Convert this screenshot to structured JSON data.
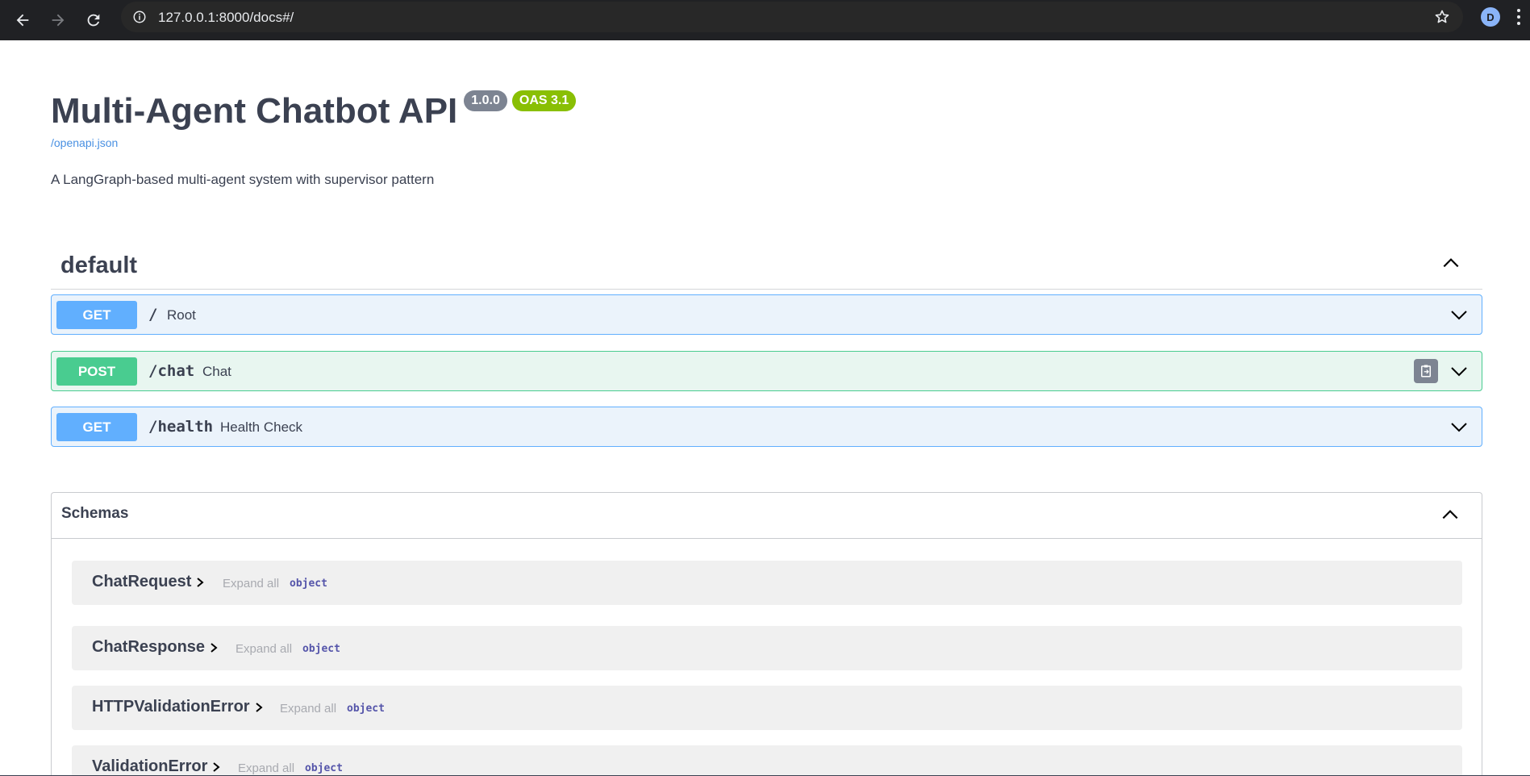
{
  "browser": {
    "url": "127.0.0.1:8000/docs#/",
    "avatar_letter": "D"
  },
  "info": {
    "title": "Multi-Agent Chatbot API",
    "version_badge": "1.0.0",
    "oas_badge": "OAS 3.1",
    "spec_link": "/openapi.json",
    "description": "A LangGraph-based multi-agent system with supervisor pattern"
  },
  "tag": {
    "name": "default",
    "operations": [
      {
        "method": "GET",
        "path": "/",
        "summary": "Root"
      },
      {
        "method": "POST",
        "path": "/chat",
        "summary": "Chat"
      },
      {
        "method": "GET",
        "path": "/health",
        "summary": "Health Check"
      }
    ]
  },
  "schemas": {
    "title": "Schemas",
    "expand_label": "Expand all",
    "items": [
      {
        "name": "ChatRequest",
        "type": "object"
      },
      {
        "name": "ChatResponse",
        "type": "object"
      },
      {
        "name": "HTTPValidationError",
        "type": "object"
      },
      {
        "name": "ValidationError",
        "type": "object"
      }
    ]
  },
  "colors": {
    "get": "#61affe",
    "post": "#49cc90",
    "link": "#4990e2"
  }
}
